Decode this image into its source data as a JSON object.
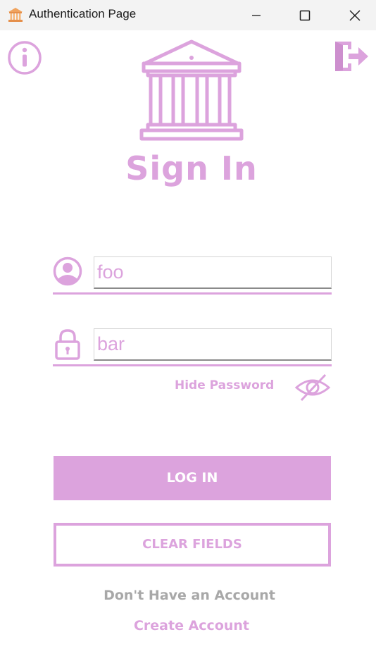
{
  "window": {
    "title": "Authentication Page",
    "controls": [
      "minimize",
      "maximize",
      "close"
    ]
  },
  "icons": {
    "app": "museum-icon",
    "info": "info-icon",
    "exit": "logout-icon",
    "logo": "museum-building-icon",
    "user": "user-icon",
    "password": "lock-icon",
    "visibility": "eye-slash-icon"
  },
  "colors": {
    "accent": "#dca3dd",
    "muted_text": "#a8a8a8",
    "titlebar": "#f3f3f3"
  },
  "form": {
    "heading": "Sign In",
    "username": {
      "value": "foo",
      "placeholder": ""
    },
    "password": {
      "value": "bar",
      "placeholder": ""
    },
    "hide_password_label": "Hide Password",
    "login_label": "LOG IN",
    "clear_label": "CLEAR FIELDS",
    "no_account_text": "Don't Have an Account",
    "create_account_label": "Create Account"
  }
}
